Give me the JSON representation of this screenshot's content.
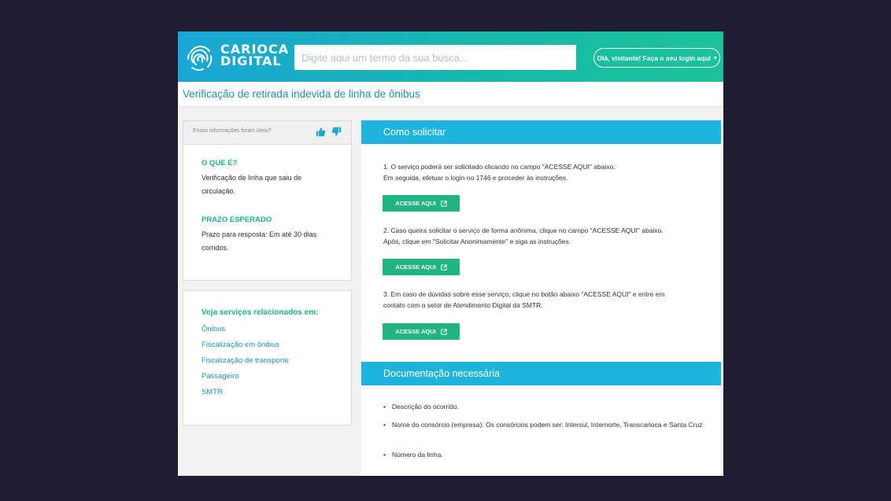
{
  "header": {
    "logo_line1": "CARIOCA",
    "logo_line2": "DIGITAL",
    "search_placeholder": "Digite aqui um termo da sua busca...",
    "login_label": "Olá, visitante! Faça o seu login aqui",
    "login_caret": "▾"
  },
  "page": {
    "title": "Verificação de retirada indevida de linha de ônibus"
  },
  "info_card": {
    "feedback_question": "Essas informações foram úteis?",
    "what_title": "O QUE É?",
    "what_text": "Verificação de linha que saiu de circulação.",
    "deadline_title": "PRAZO ESPERADO",
    "deadline_text": "Prazo para resposta: Em até 30 dias corridos."
  },
  "related": {
    "title": "Veja serviços relacionados em:",
    "links": [
      "Ônibus",
      "Fiscalização em ônibus",
      "Fiscalização de transporte",
      "Passageiro",
      "SMTR"
    ]
  },
  "how_to": {
    "title": "Como solicitar",
    "steps": [
      {
        "line1": "1.  O serviço poderá ser solicitado clicando no campo \"ACESSE AQUI\" abaixo.",
        "line2": "Em seguida, efetuar o login no 1746 e proceder às instruções.",
        "button": "ACESSE AQUI"
      },
      {
        "line1": "2.  Caso queira solicitar o serviço de forma anônima, clique no campo \"ACESSE AQUI\" abaixo.",
        "line2": "Após, clique em \"Solicitar Anonimamente\" e siga as instruções.",
        "button": "ACESSE AQUI"
      },
      {
        "line1": "3.  Em caso de dúvidas sobre esse serviço, clique no botão abaixo \"ACESSE AQUI\" e entre em",
        "line2": "contato com o setor de Atendimento Digital da SMTR.",
        "button": "ACESSE AQUI"
      }
    ]
  },
  "documents": {
    "title": "Documentação necessária",
    "bullet": "•",
    "items": [
      "Descrição do ocorrido.",
      "Nome do consórcio (empresa). Os consórcios podem ser: Intersul, Internorte, Transcarioca e Santa Cruz",
      "Número da linha."
    ]
  },
  "colors": {
    "accent_green": "#20b582",
    "section_blue": "#1eb4dd",
    "link_blue": "#1f8fbd",
    "backdrop": "#201d33"
  },
  "icons": {
    "logo": "fingerprint-icon",
    "like": "thumbs-up-icon",
    "dislike": "thumbs-down-icon",
    "external": "external-link-icon"
  }
}
